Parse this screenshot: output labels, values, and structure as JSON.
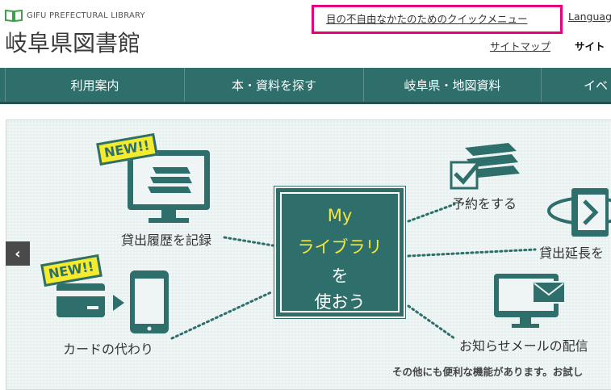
{
  "header": {
    "logo_en": "GIFU PREFECTURAL LIBRARY",
    "logo_ja": "岐阜県図書館",
    "quick_menu": "目の不自由なかたのためのクイックメニュー",
    "language": "Languag",
    "sitemap": "サイトマップ",
    "site_search": "サイト"
  },
  "nav": {
    "items": [
      "利用案内",
      "本・資料を探す",
      "岐阜県・地図資料",
      "イベ"
    ]
  },
  "hero": {
    "center": {
      "line1": "My",
      "line2": "ライブラリ",
      "line3": "を",
      "line4": "使おう"
    },
    "new_badge": "NEW!!",
    "labels": {
      "history": "貸出履歴を記録",
      "card": "カードの代わり",
      "reserve": "予約をする",
      "extend": "貸出延長を",
      "mail": "お知らせメールの配信",
      "more": "その他にも便利な機能があります。お試し"
    },
    "prev_arrow": "‹"
  },
  "colors": {
    "brand_teal": "#2e6e6b",
    "highlight_yellow": "#f5e73a",
    "focus_box": "#e6007e"
  }
}
